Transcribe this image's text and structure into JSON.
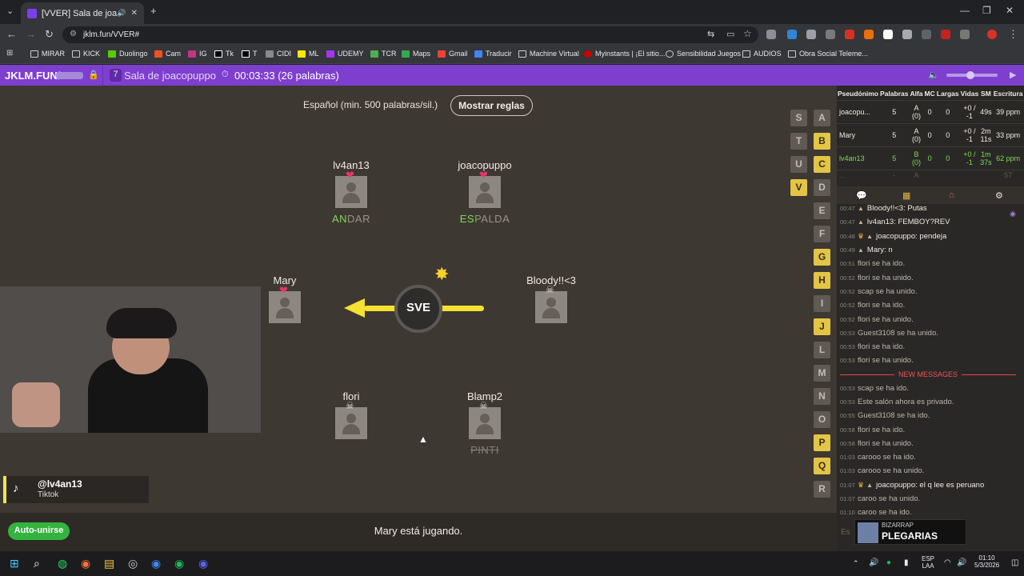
{
  "browser": {
    "tab_title": "[VVER] Sala de joacopuppo",
    "url": "jklm.fun/VVER#",
    "bookmarks": [
      "MIRAR",
      "KICK",
      "Duolingo",
      "Cam",
      "IG",
      "Tk",
      "T",
      "CIDI",
      "ML",
      "UDEMY",
      "TCR",
      "Maps",
      "Gmail",
      "Traducir",
      "Machine Virtual",
      "Myinstants | ¡El sitio...",
      "Sensibilidad Juegos",
      "AUDIOS",
      "Obra Social Teleme..."
    ]
  },
  "site": {
    "logo": "JKLM.FUN/",
    "player_count": "7",
    "room_name": "Sala de joacopuppo",
    "timer": "00:03:33 (26 palabras)"
  },
  "game": {
    "rules_language": "Español (min. 500 palabras/sil.)",
    "rules_button": "Mostrar reglas",
    "syllable": "SVE",
    "players": [
      {
        "name": "lv4an13",
        "state": "heart",
        "word_hl": "AN",
        "word_rest": "DAR"
      },
      {
        "name": "joacopuppo",
        "state": "heart",
        "word_hl": "ES",
        "word_rest": "PALDA"
      },
      {
        "name": "Mary",
        "state": "heart",
        "word_hl": "",
        "word_rest": ""
      },
      {
        "name": "Bloody!!<3",
        "state": "dead",
        "word_hl": "",
        "word_rest": ""
      },
      {
        "name": "flori",
        "state": "dead",
        "word_hl": "",
        "word_rest": ""
      },
      {
        "name": "Blamp2",
        "state": "dead",
        "word_hl": "",
        "word_rest": "PINTI"
      }
    ],
    "letters_col2": [
      "A",
      "B",
      "C",
      "D",
      "E",
      "F",
      "G",
      "H",
      "I",
      "J",
      "L",
      "M",
      "N",
      "O",
      "P",
      "Q",
      "R"
    ],
    "letters_col1": [
      "S",
      "T",
      "U",
      "V"
    ],
    "active_letters": [
      "B",
      "C",
      "G",
      "H",
      "J",
      "P",
      "Q",
      "V"
    ],
    "status": "Mary está jugando.",
    "auto_join": "Auto-unirse"
  },
  "tiktok": {
    "handle": "@lv4an13",
    "sub": "Tiktok"
  },
  "scoreboard": {
    "headers": [
      "Pseudónimo",
      "Palabras",
      "Alfa",
      "MC",
      "Largas",
      "Vidas",
      "SM",
      "Escritura"
    ],
    "rows": [
      {
        "name": "joacopu...",
        "words": "5",
        "alfa": "A (0)",
        "mc": "0",
        "largas": "0",
        "vidas": "+0 / -1",
        "sm": "49s",
        "esc": "39 ppm"
      },
      {
        "name": "Mary",
        "words": "5",
        "alfa": "A (0)",
        "mc": "0",
        "largas": "0",
        "vidas": "+0 / -1",
        "sm": "2m 11s",
        "esc": "33 ppm"
      },
      {
        "name": "lv4an13",
        "words": "5",
        "alfa": "B (0)",
        "mc": "0",
        "largas": "0",
        "vidas": "+0 / -1",
        "sm": "1m 37s",
        "esc": "62 ppm"
      },
      {
        "name": "...",
        "words": "-",
        "alfa": "A",
        "mc": "",
        "largas": "",
        "vidas": "",
        "sm": "",
        "esc": "57"
      }
    ]
  },
  "chat": [
    {
      "t": "00:47",
      "kind": "user",
      "name": "Bloody!!<3",
      "text": "Putas"
    },
    {
      "t": "00:47",
      "kind": "user",
      "name": "lv4an13",
      "text": "FEMBOY?REV"
    },
    {
      "t": "00:48",
      "kind": "owner",
      "name": "joacopuppo",
      "text": "pendeja"
    },
    {
      "t": "00:49",
      "kind": "user",
      "name": "Mary",
      "text": "n"
    },
    {
      "t": "00:51",
      "kind": "event",
      "text": "flori se ha ido."
    },
    {
      "t": "00:52",
      "kind": "event",
      "text": "flori se ha unido."
    },
    {
      "t": "00:52",
      "kind": "event",
      "text": "scap se ha unido."
    },
    {
      "t": "00:52",
      "kind": "event",
      "text": "flori se ha ido."
    },
    {
      "t": "00:52",
      "kind": "event",
      "text": "flori se ha unido."
    },
    {
      "t": "00:53",
      "kind": "event",
      "text": "Guest3108 se ha unido."
    },
    {
      "t": "00:53",
      "kind": "event",
      "text": "flori se ha ido."
    },
    {
      "t": "00:53",
      "kind": "event",
      "text": "flori se ha unido."
    },
    {
      "kind": "divider",
      "text": "NEW MESSAGES"
    },
    {
      "t": "00:53",
      "kind": "event",
      "text": "scap se ha ido."
    },
    {
      "t": "00:53",
      "kind": "event",
      "text": "Este salón ahora es privado."
    },
    {
      "t": "00:55",
      "kind": "event",
      "text": "Guest3108 se ha ido."
    },
    {
      "t": "00:58",
      "kind": "event",
      "text": "flori se ha ido."
    },
    {
      "t": "00:58",
      "kind": "event",
      "text": "flori se ha unido."
    },
    {
      "t": "01:03",
      "kind": "event",
      "text": "carooo se ha ido."
    },
    {
      "t": "01:03",
      "kind": "event",
      "text": "carooo se ha unido."
    },
    {
      "t": "01:07",
      "kind": "owner",
      "name": "joacopuppo",
      "text": "el q lee es peruano"
    },
    {
      "t": "01:07",
      "kind": "event",
      "text": "caroo se ha unido."
    },
    {
      "t": "01:10",
      "kind": "event",
      "text": "caroo se ha ido."
    }
  ],
  "chat_input_placeholder": "Es",
  "music": {
    "artist": "BIZARRAP",
    "song": "PLEGARIAS"
  },
  "taskbar": {
    "lang": "ESP",
    "lang2": "LAA",
    "time": "01:10",
    "date": "5/3/2026"
  }
}
